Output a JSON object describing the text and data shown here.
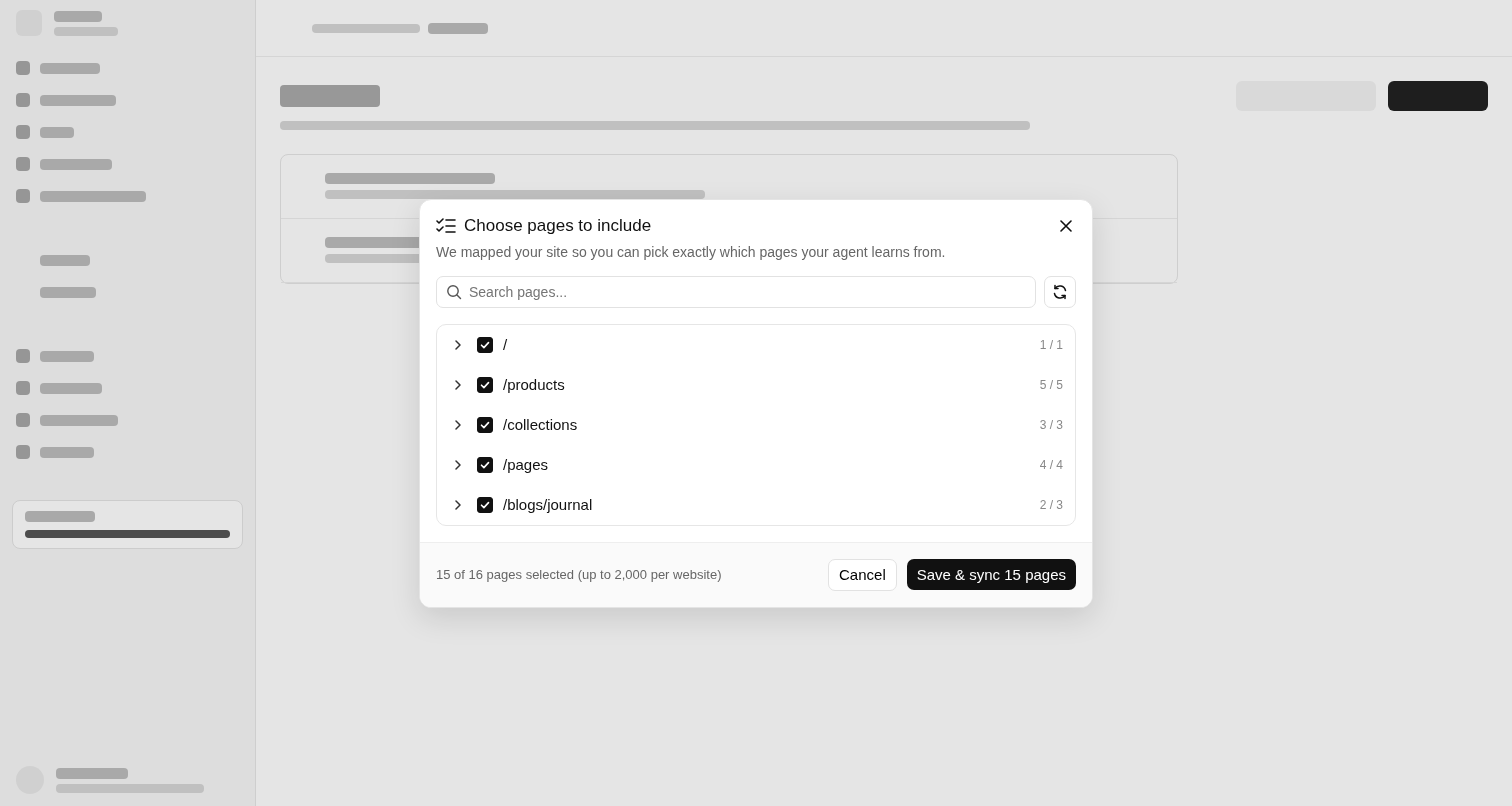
{
  "sidebar": {
    "credits": {
      "level": 1
    }
  },
  "dialog": {
    "title": "Choose pages to include",
    "description": "We mapped your site so you can pick exactly which pages your agent learns from.",
    "search": {
      "placeholder": "Search pages..."
    },
    "tree": [
      {
        "path": "/",
        "count": "1 / 1",
        "checked": true,
        "expanded": false
      },
      {
        "path": "/products",
        "count": "5 / 5",
        "checked": true,
        "expanded": false
      },
      {
        "path": "/collections",
        "count": "3 / 3",
        "checked": true,
        "expanded": false
      },
      {
        "path": "/pages",
        "count": "4 / 4",
        "checked": true,
        "expanded": false
      },
      {
        "path": "/blogs/journal",
        "count": "2 / 3",
        "checked": true,
        "expanded": false
      }
    ],
    "summary": "15 of 16 pages selected (up to 2,000 per website)",
    "cancel": "Cancel",
    "confirm": "Save & sync 15 pages"
  }
}
